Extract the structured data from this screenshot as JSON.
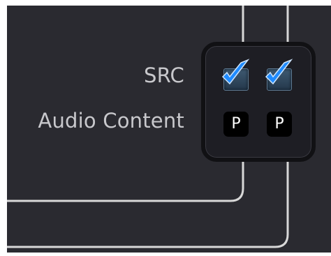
{
  "rows": [
    {
      "label": "SRC",
      "cells": [
        {
          "type": "checkbox",
          "checked": true
        },
        {
          "type": "checkbox",
          "checked": true
        }
      ]
    },
    {
      "label": "Audio Content",
      "cells": [
        {
          "type": "p-button",
          "text": "P"
        },
        {
          "type": "p-button",
          "text": "P"
        }
      ]
    }
  ],
  "colors": {
    "background": "#2a2a30",
    "wire": "#d8d8d8",
    "check_accent": "#1f8bff",
    "matrix_bg": "#1e1e24",
    "button_bg": "#000000"
  }
}
